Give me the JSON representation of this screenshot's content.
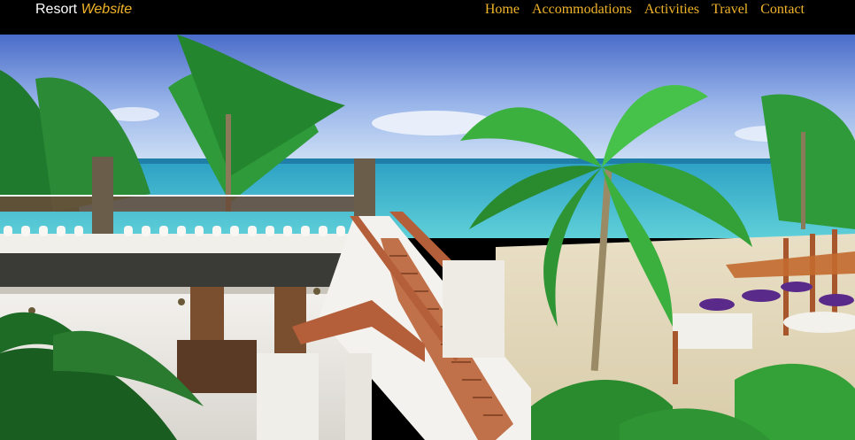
{
  "brand": {
    "name": "Resort",
    "accent": "Website"
  },
  "nav": {
    "items": [
      "Home",
      "Accommodations",
      "Activities",
      "Travel",
      "Contact"
    ]
  },
  "colors": {
    "accent": "#f0b429",
    "header_bg": "#000000"
  },
  "hero": {
    "image": "tropical-resort-beach-photo"
  }
}
